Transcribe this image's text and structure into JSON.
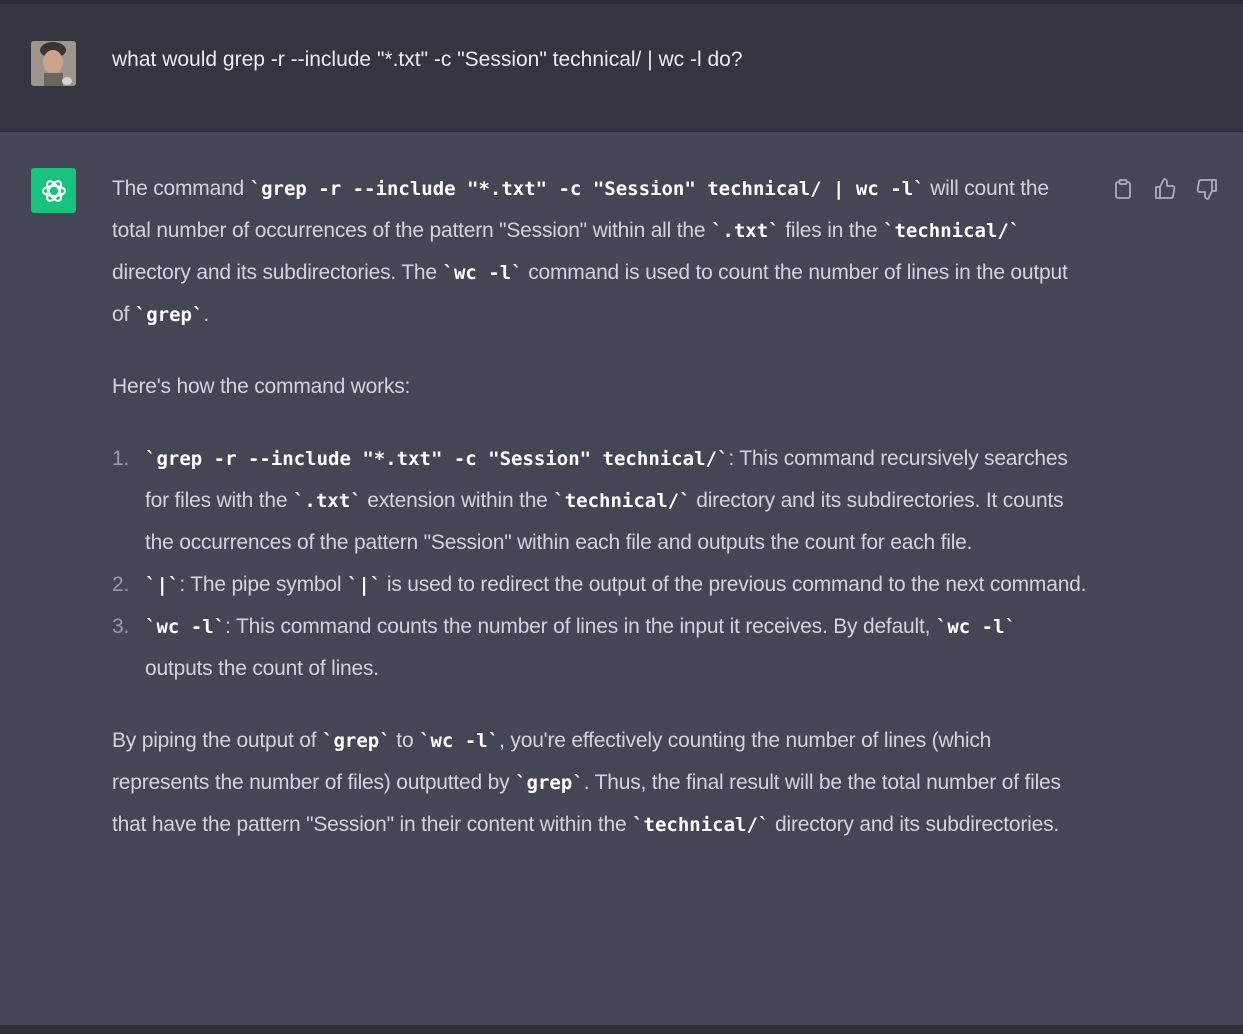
{
  "user_message": {
    "text": "what would grep -r --include \"*.txt\" -c \"Session\" technical/ | wc -l do?"
  },
  "assistant_message": {
    "para1": {
      "t1": "The command ",
      "c1": "`grep -r --include \"*.txt\" -c \"Session\" technical/ | wc -l`",
      "t2": " will count the total number of occurrences of the pattern \"Session\" within all the ",
      "c2": "`.txt`",
      "t3": " files in the ",
      "c3": "`technical/`",
      "t4": " directory and its subdirectories. The ",
      "c4": "`wc -l`",
      "t5": " command is used to count the number of lines in the output of ",
      "c5": "`grep`",
      "t6": "."
    },
    "para2": "Here's how the command works:",
    "list": [
      {
        "num": "1.",
        "c1": "`grep -r --include \"*.txt\" -c \"Session\" technical/`",
        "t1": ": This command recursively searches for files with the ",
        "c2": "`.txt`",
        "t2": " extension within the ",
        "c3": "`technical/`",
        "t3": " directory and its subdirectories. It counts the occurrences of the pattern \"Session\" within each file and outputs the count for each file."
      },
      {
        "num": "2.",
        "c1": "`|`",
        "t1": ": The pipe symbol ",
        "c2": "`|`",
        "t2": " is used to redirect the output of the previous command to the next command."
      },
      {
        "num": "3.",
        "c1": "`wc -l`",
        "t1": ": This command counts the number of lines in the input it receives. By default, ",
        "c2": "`wc -l`",
        "t2": " outputs the count of lines."
      }
    ],
    "para3": {
      "t1": "By piping the output of ",
      "c1": "`grep`",
      "t2": " to ",
      "c2": "`wc -l`",
      "t3": ", you're effectively counting the number of lines (which represents the number of files) outputted by ",
      "c3": "`grep`",
      "t4": ". Thus, the final result will be the total number of files that have the pattern \"Session\" in their content within the ",
      "c4": "`technical/`",
      "t5": " directory and its subdirectories."
    }
  },
  "actions": {
    "copy_icon": "clipboard-icon",
    "like_icon": "thumbs-up-icon",
    "dislike_icon": "thumbs-down-icon"
  },
  "colors": {
    "background": "#343541",
    "assistant_bg": "#444654",
    "brand_green": "#19c37d",
    "text": "#d1d5db"
  }
}
